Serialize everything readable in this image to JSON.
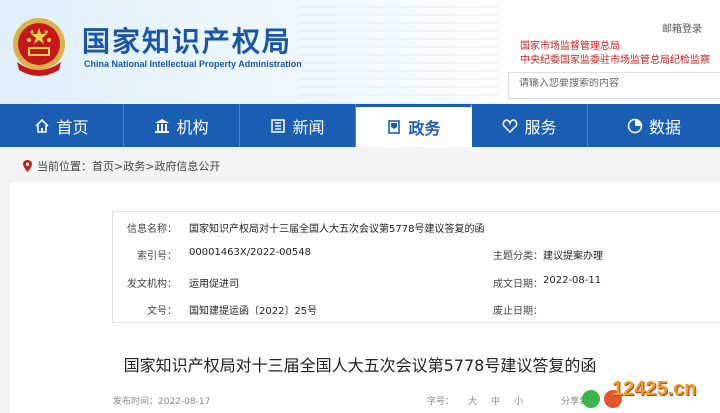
{
  "header": {
    "title": "国家知识产权局",
    "subtitle": "China National Intellectual Property Administration",
    "mail": "邮箱登录",
    "link1": "国家市场监督管理总局",
    "link2": "中央纪委国家监委驻市场监管总局纪检监察",
    "search_placeholder": "请输入您要搜索的内容"
  },
  "nav": [
    {
      "label": "首页",
      "icon": "home-icon"
    },
    {
      "label": "机构",
      "icon": "institution-icon"
    },
    {
      "label": "新闻",
      "icon": "news-icon"
    },
    {
      "label": "政务",
      "icon": "government-icon",
      "active": true
    },
    {
      "label": "服务",
      "icon": "service-icon"
    },
    {
      "label": "数据",
      "icon": "data-icon"
    }
  ],
  "breadcrumb": {
    "prefix": "当前位置：",
    "home": "首页",
    "sep": ">",
    "section": "政务",
    "current": "政府信息公开"
  },
  "info": {
    "name_label": "信息名称：",
    "name_value": "国家知识产权局对十三届全国人大五次会议第5778号建议答复的函",
    "index_label": "索引号：",
    "index_value": "00001463X/2022-00548",
    "topic_label": "主题分类：",
    "topic_value": "建议提案办理",
    "issuer_label": "发文机构：",
    "issuer_value": "运用促进司",
    "date_label": "成文日期：",
    "date_value": "2022-08-11",
    "docno_label": "文号：",
    "docno_value": "国知建提运函〔2022〕25号",
    "expire_label": "废止日期："
  },
  "article": {
    "title": "国家知识产权局对十三届全国人大五次会议第5778号建议答复的函",
    "publish_date": "发布时间：2022-08-17",
    "font_label": "字号：",
    "font_large": "大",
    "font_medium": "中",
    "font_small": "小",
    "share_label": "分享到："
  },
  "watermark": "12425.cn",
  "colors": {
    "brand": "#1a5eb4",
    "alert": "#c81e1e"
  }
}
